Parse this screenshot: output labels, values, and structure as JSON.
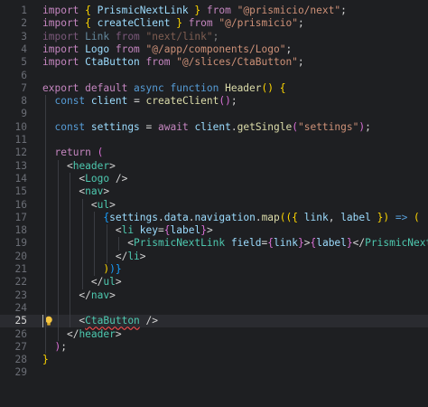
{
  "editor": {
    "lines": [
      {
        "no": "1",
        "tokens": [
          [
            "kw",
            "import "
          ],
          [
            "br1",
            "{ "
          ],
          [
            "var",
            "PrismicNextLink"
          ],
          [
            "br1",
            " }"
          ],
          [
            "kw",
            " from "
          ],
          [
            "str",
            "\"@prismicio/next\""
          ],
          [
            "id",
            ";"
          ]
        ]
      },
      {
        "no": "2",
        "tokens": [
          [
            "kw",
            "import "
          ],
          [
            "br1",
            "{ "
          ],
          [
            "var",
            "createClient"
          ],
          [
            "br1",
            " }"
          ],
          [
            "kw",
            " from "
          ],
          [
            "str",
            "\"@/prismicio\""
          ],
          [
            "id",
            ";"
          ]
        ]
      },
      {
        "no": "3",
        "dim": true,
        "tokens": [
          [
            "kw",
            "import "
          ],
          [
            "var",
            "Link"
          ],
          [
            "kw",
            " from "
          ],
          [
            "str",
            "\"next/link\""
          ],
          [
            "id",
            ";"
          ]
        ]
      },
      {
        "no": "4",
        "tokens": [
          [
            "kw",
            "import "
          ],
          [
            "var",
            "Logo"
          ],
          [
            "kw",
            " from "
          ],
          [
            "str",
            "\"@/app/components/Logo\""
          ],
          [
            "id",
            ";"
          ]
        ]
      },
      {
        "no": "5",
        "tokens": [
          [
            "kw",
            "import "
          ],
          [
            "var",
            "CtaButton"
          ],
          [
            "kw",
            " from "
          ],
          [
            "str",
            "\"@/slices/CtaButton\""
          ],
          [
            "id",
            ";"
          ]
        ]
      },
      {
        "no": "6",
        "tokens": []
      },
      {
        "no": "7",
        "tokens": [
          [
            "kw",
            "export "
          ],
          [
            "kw",
            "default "
          ],
          [
            "def",
            "async "
          ],
          [
            "def",
            "function "
          ],
          [
            "fn",
            "Header"
          ],
          [
            "br1",
            "() "
          ],
          [
            "br1",
            "{"
          ]
        ]
      },
      {
        "no": "8",
        "tokens": [
          [
            "id",
            "  "
          ],
          [
            "def",
            "const "
          ],
          [
            "var",
            "client"
          ],
          [
            "id",
            " = "
          ],
          [
            "fn",
            "createClient"
          ],
          [
            "br2",
            "()"
          ],
          [
            "id",
            ";"
          ]
        ]
      },
      {
        "no": "9",
        "tokens": []
      },
      {
        "no": "10",
        "tokens": [
          [
            "id",
            "  "
          ],
          [
            "def",
            "const "
          ],
          [
            "var",
            "settings"
          ],
          [
            "id",
            " = "
          ],
          [
            "kw",
            "await "
          ],
          [
            "var",
            "client"
          ],
          [
            "id",
            "."
          ],
          [
            "fn",
            "getSingle"
          ],
          [
            "br2",
            "("
          ],
          [
            "str",
            "\"settings\""
          ],
          [
            "br2",
            ")"
          ],
          [
            "id",
            ";"
          ]
        ]
      },
      {
        "no": "11",
        "tokens": []
      },
      {
        "no": "12",
        "tokens": [
          [
            "id",
            "  "
          ],
          [
            "kw",
            "return "
          ],
          [
            "br2",
            "("
          ]
        ]
      },
      {
        "no": "13",
        "tokens": [
          [
            "id",
            "    "
          ],
          [
            "id",
            "<"
          ],
          [
            "tag",
            "header"
          ],
          [
            "id",
            ">"
          ]
        ]
      },
      {
        "no": "14",
        "tokens": [
          [
            "id",
            "      "
          ],
          [
            "id",
            "<"
          ],
          [
            "tag",
            "Logo"
          ],
          [
            "id",
            " />"
          ]
        ]
      },
      {
        "no": "15",
        "tokens": [
          [
            "id",
            "      "
          ],
          [
            "id",
            "<"
          ],
          [
            "tag",
            "nav"
          ],
          [
            "id",
            ">"
          ]
        ]
      },
      {
        "no": "16",
        "tokens": [
          [
            "id",
            "        "
          ],
          [
            "id",
            "<"
          ],
          [
            "tag",
            "ul"
          ],
          [
            "id",
            ">"
          ]
        ]
      },
      {
        "no": "17",
        "tokens": [
          [
            "id",
            "          "
          ],
          [
            "br3",
            "{"
          ],
          [
            "var",
            "settings"
          ],
          [
            "id",
            "."
          ],
          [
            "var",
            "data"
          ],
          [
            "id",
            "."
          ],
          [
            "var",
            "navigation"
          ],
          [
            "id",
            "."
          ],
          [
            "fn",
            "map"
          ],
          [
            "br1",
            "(("
          ],
          [
            "br1",
            "{ "
          ],
          [
            "var",
            "link"
          ],
          [
            "id",
            ", "
          ],
          [
            "var",
            "label"
          ],
          [
            "br1",
            " })"
          ],
          [
            "def",
            " => "
          ],
          [
            "br1",
            "("
          ]
        ]
      },
      {
        "no": "18",
        "tokens": [
          [
            "id",
            "            "
          ],
          [
            "id",
            "<"
          ],
          [
            "tag",
            "li "
          ],
          [
            "attr",
            "key"
          ],
          [
            "id",
            "="
          ],
          [
            "br2",
            "{"
          ],
          [
            "var",
            "label"
          ],
          [
            "br2",
            "}"
          ],
          [
            "id",
            ">"
          ]
        ]
      },
      {
        "no": "19",
        "tokens": [
          [
            "id",
            "              "
          ],
          [
            "id",
            "<"
          ],
          [
            "tag",
            "PrismicNextLink "
          ],
          [
            "attr",
            "field"
          ],
          [
            "id",
            "="
          ],
          [
            "br2",
            "{"
          ],
          [
            "var",
            "link"
          ],
          [
            "br2",
            "}"
          ],
          [
            "id",
            ">"
          ],
          [
            "br2",
            "{"
          ],
          [
            "var",
            "label"
          ],
          [
            "br2",
            "}"
          ],
          [
            "id",
            "</"
          ],
          [
            "tag",
            "PrismicNextLink"
          ],
          [
            "id",
            ">"
          ]
        ]
      },
      {
        "no": "20",
        "tokens": [
          [
            "id",
            "            "
          ],
          [
            "id",
            "</"
          ],
          [
            "tag",
            "li"
          ],
          [
            "id",
            ">"
          ]
        ]
      },
      {
        "no": "21",
        "tokens": [
          [
            "id",
            "          "
          ],
          [
            "br1",
            ")"
          ],
          [
            "br3",
            ")}"
          ]
        ]
      },
      {
        "no": "22",
        "tokens": [
          [
            "id",
            "        "
          ],
          [
            "id",
            "</"
          ],
          [
            "tag",
            "ul"
          ],
          [
            "id",
            ">"
          ]
        ]
      },
      {
        "no": "23",
        "tokens": [
          [
            "id",
            "      "
          ],
          [
            "id",
            "</"
          ],
          [
            "tag",
            "nav"
          ],
          [
            "id",
            ">"
          ]
        ]
      },
      {
        "no": "24",
        "tokens": []
      },
      {
        "no": "25",
        "active": true,
        "tokens": [
          [
            "id",
            "      "
          ],
          [
            "id",
            "<"
          ],
          [
            "tag",
            "CtaButton"
          ],
          [
            "id",
            " />"
          ]
        ]
      },
      {
        "no": "26",
        "tokens": [
          [
            "id",
            "    "
          ],
          [
            "id",
            "</"
          ],
          [
            "tag",
            "header"
          ],
          [
            "id",
            ">"
          ]
        ]
      },
      {
        "no": "27",
        "tokens": [
          [
            "id",
            "  "
          ],
          [
            "br2",
            ")"
          ],
          [
            "id",
            ";"
          ]
        ]
      },
      {
        "no": "28",
        "tokens": [
          [
            "br1",
            "}"
          ]
        ]
      },
      {
        "no": "29",
        "tokens": []
      }
    ],
    "lightbulb_icon": "lightbulb-icon",
    "colors": {
      "background": "#1e1f22",
      "active_line": "#2a2b30",
      "keyword": "#c586c0",
      "string": "#ce9178",
      "function": "#dcdcaa",
      "tag": "#4ec9b0",
      "variable": "#9cdcfe"
    }
  }
}
